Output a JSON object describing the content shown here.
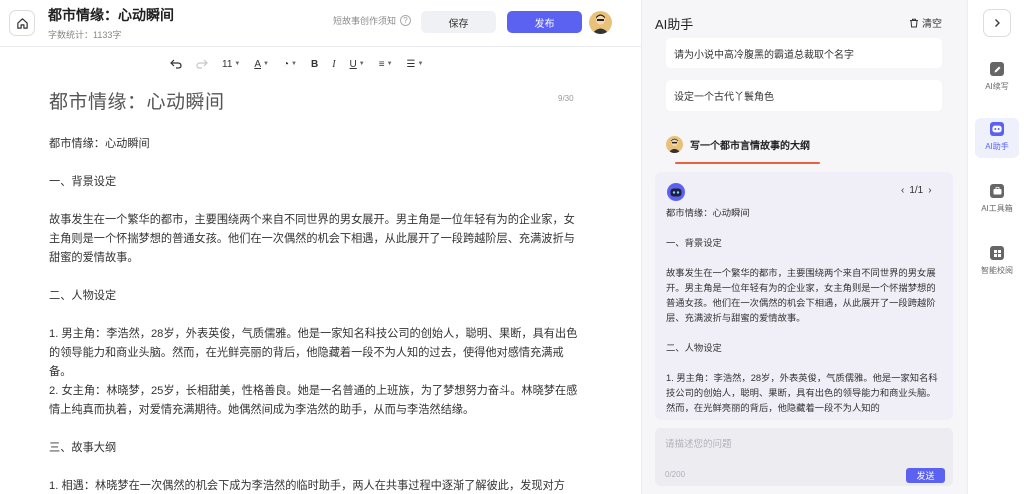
{
  "header": {
    "title": "都市情缘：心动瞬间",
    "word_count_label": "字数统计：",
    "word_count": "1133字",
    "guide_text": "短故事创作须知",
    "save_label": "保存",
    "publish_label": "发布"
  },
  "editor": {
    "heading": "都市情缘：心动瞬间",
    "title_count": "9/30",
    "toolbar": {
      "font_size": "11",
      "undo_icon": "undo-icon",
      "redo_icon": "redo-icon"
    },
    "paragraphs": [
      "都市情缘：心动瞬间",
      "一、背景设定",
      "故事发生在一个繁华的都市，主要围绕两个来自不同世界的男女展开。男主角是一位年轻有为的企业家，女主角则是一个怀揣梦想的普通女孩。他们在一次偶然的机会下相遇，从此展开了一段跨越阶层、充满波折与甜蜜的爱情故事。",
      "二、人物设定",
      "1. 男主角：李浩然，28岁，外表英俊，气质儒雅。他是一家知名科技公司的创始人，聪明、果断，具有出色的领导能力和商业头脑。然而，在光鲜亮丽的背后，他隐藏着一段不为人知的过去，使得他对感情充满戒备。",
      "2. 女主角：林晓梦，25岁，长相甜美，性格善良。她是一名普通的上班族，为了梦想努力奋斗。林晓梦在感情上纯真而执着，对爱情充满期待。她偶然间成为李浩然的助手，从而与李浩然结缘。",
      "三、故事大纲",
      "1. 相遇：林晓梦在一次偶然的机会下成为李浩然的临时助手，两人在共事过程中逐渐了解彼此，发现对方"
    ]
  },
  "ai": {
    "title": "AI助手",
    "clear_label": "清空",
    "suggestions": [
      "请为小说中高冷腹黑的霸道总裁取个名字",
      "设定一个古代丫鬟角色"
    ],
    "user_question": "写一个都市言情故事的大纲",
    "pager": "1/1",
    "answer_paragraphs": [
      "都市情缘：心动瞬间",
      "一、背景设定",
      "故事发生在一个繁华的都市，主要围绕两个来自不同世界的男女展开。男主角是一位年轻有为的企业家，女主角则是一个怀揣梦想的普通女孩。他们在一次偶然的机会下相遇，从此展开了一段跨越阶层、充满波折与甜蜜的爱情故事。",
      "二、人物设定",
      "1. 男主角：李浩然，28岁，外表英俊，气质儒雅。他是一家知名科技公司的创始人，聪明、果断，具有出色的领导能力和商业头脑。然而，在光鲜亮丽的背后，他隐藏着一段不为人知的"
    ],
    "input_placeholder": "请描述您的问题",
    "char_count": "0/200",
    "send_label": "发送"
  },
  "sidebar": {
    "items": [
      {
        "label": "AI续写",
        "icon": "pen-icon",
        "active": false
      },
      {
        "label": "AI助手",
        "icon": "bot-icon",
        "active": true
      },
      {
        "label": "AI工具箱",
        "icon": "toolbox-icon",
        "active": false
      },
      {
        "label": "智能校阅",
        "icon": "proofread-icon",
        "active": false
      }
    ]
  },
  "colors": {
    "accent": "#5b62f2",
    "underline": "#e8603c"
  }
}
